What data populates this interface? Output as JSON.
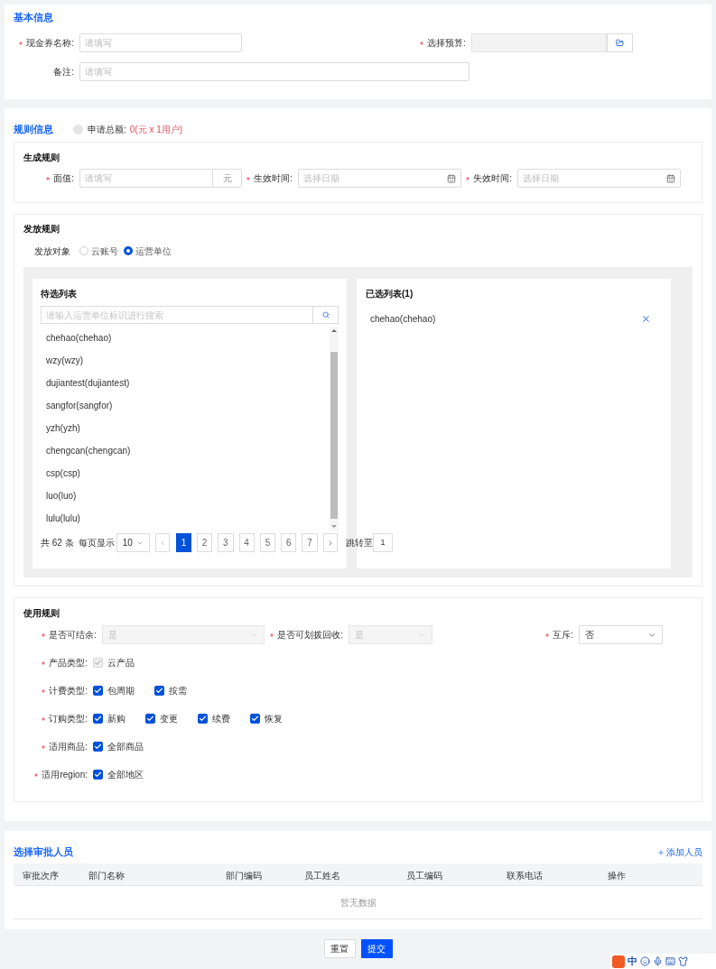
{
  "basic_info": {
    "title": "基本信息",
    "fields": [
      {
        "kind": "input",
        "label": "现金券名称:",
        "required": true,
        "placeholder": "请填写"
      },
      {
        "kind": "picker",
        "label": "选择预算:",
        "required": true
      },
      {
        "kind": "input",
        "label": "备注:",
        "required": false,
        "placeholder": "请填写"
      }
    ]
  },
  "rule_info": {
    "title": "规则信息",
    "total_label": "申请总额:",
    "total_value": "0(元 x 1用户)",
    "generate_rule": {
      "title": "生成规则",
      "fields": [
        {
          "kind": "amount",
          "label": "面值:",
          "required": true,
          "placeholder": "请填写",
          "suffix": "元"
        },
        {
          "kind": "date",
          "label": "生效时间:",
          "required": true,
          "placeholder": "选择日期"
        },
        {
          "kind": "date",
          "label": "失效时间:",
          "required": true,
          "placeholder": "选择日期"
        }
      ]
    },
    "issue_rule": {
      "title": "发放规则",
      "target_label": "发放对象",
      "target_options": [
        {
          "label": "云账号",
          "selected": false
        },
        {
          "label": "运营单位",
          "selected": true
        }
      ],
      "candidates": {
        "title": "待选列表",
        "search_placeholder": "请输入运营单位标识进行搜索",
        "items": [
          "chehao(chehao)",
          "wzy(wzy)",
          "dujiantest(dujiantest)",
          "sangfor(sangfor)",
          "yzh(yzh)",
          "chengcan(chengcan)",
          "csp(csp)",
          "luo(luo)",
          "lulu(lulu)"
        ],
        "pagination": {
          "total": "共 62 条",
          "per_page_label": "每页显示",
          "per_page": "10",
          "pages": [
            {
              "label": "1",
              "selected": true
            },
            {
              "label": "2",
              "selected": false
            },
            {
              "label": "3",
              "selected": false
            },
            {
              "label": "4",
              "selected": false
            },
            {
              "label": "5",
              "selected": false
            },
            {
              "label": "6",
              "selected": false
            },
            {
              "label": "7",
              "selected": false
            }
          ],
          "jump_label": "跳转至",
          "jump_value": "1"
        }
      },
      "selected_list": {
        "title": "已选列表(1)",
        "items": [
          "chehao(chehao)"
        ]
      }
    },
    "usage_rule": {
      "title": "使用规则",
      "rows": [
        {
          "kind": "selects",
          "items": [
            {
              "label": "是否可结余:",
              "required": true,
              "value": "是",
              "disabled": true
            },
            {
              "label": "是否可划拨回收:",
              "required": true,
              "value": "是",
              "disabled": true
            },
            {
              "label": "互斥:",
              "required": true,
              "value": "否",
              "disabled": false
            }
          ]
        },
        {
          "kind": "checks",
          "label": "产品类型:",
          "required": true,
          "options": [
            {
              "label": "云产品",
              "checked": true,
              "disabled": true
            }
          ]
        },
        {
          "kind": "checks",
          "label": "计费类型:",
          "required": true,
          "options": [
            {
              "label": "包周期",
              "checked": true,
              "disabled": false
            },
            {
              "label": "按需",
              "checked": true,
              "disabled": false
            }
          ]
        },
        {
          "kind": "checks",
          "label": "订购类型:",
          "required": true,
          "options": [
            {
              "label": "新购",
              "checked": true,
              "disabled": false
            },
            {
              "label": "变更",
              "checked": true,
              "disabled": false
            },
            {
              "label": "续费",
              "checked": true,
              "disabled": false
            },
            {
              "label": "恢复",
              "checked": true,
              "disabled": false
            }
          ]
        },
        {
          "kind": "checks",
          "label": "适用商品:",
          "required": true,
          "options": [
            {
              "label": "全部商品",
              "checked": true,
              "disabled": false
            }
          ]
        },
        {
          "kind": "checks",
          "label": "适用region:",
          "required": true,
          "options": [
            {
              "label": "全部地区",
              "checked": true,
              "disabled": false
            }
          ]
        }
      ]
    }
  },
  "approvers": {
    "title": "选择审批人员",
    "add_label": "添加人员",
    "columns": [
      "审批次序",
      "部门名称",
      "部门编码",
      "员工姓名",
      "员工编码",
      "联系电话",
      "操作"
    ],
    "empty_text": "暂无数据"
  },
  "buttons": [
    {
      "kind": "default",
      "label": "重置"
    },
    {
      "kind": "primary",
      "label": "提交"
    }
  ],
  "ime_bar": {
    "label": "中"
  }
}
